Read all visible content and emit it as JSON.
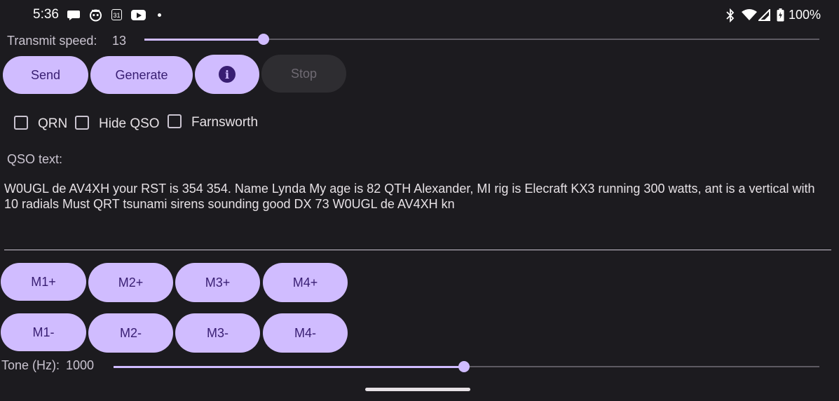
{
  "status_bar": {
    "time": "5:36",
    "calendar_day": "31",
    "battery": "100%",
    "icons": [
      "chat-bubble-icon",
      "robot-icon",
      "calendar-icon",
      "youtube-icon",
      "dot-icon",
      "bluetooth-icon",
      "wifi-icon",
      "signal-icon",
      "battery-icon"
    ]
  },
  "transmit": {
    "label": "Transmit speed:",
    "value": "13",
    "slider_fraction": 0.177
  },
  "buttons": {
    "send": "Send",
    "generate": "Generate",
    "info": "i",
    "stop": "Stop"
  },
  "checkboxes": {
    "qrn": "QRN",
    "hide_qso": "Hide QSO",
    "farnsworth": "Farnsworth"
  },
  "qso": {
    "label": "QSO text:",
    "text": "W0UGL de AV4XH your RST is 354 354. Name Lynda My age is 82 QTH Alexander, MI rig is Elecraft KX3 running 300 watts, ant is a vertical with 10 radials Must QRT tsunami sirens sounding good DX 73  W0UGL de AV4XH kn"
  },
  "memory": {
    "plus": [
      "M1+",
      "M2+",
      "M3+",
      "M4+"
    ],
    "minus": [
      "M1-",
      "M2-",
      "M3-",
      "M4-"
    ]
  },
  "tone": {
    "label": "Tone (Hz):",
    "value": "1000",
    "slider_fraction": 0.497
  },
  "colors": {
    "background": "#1c1b1f",
    "accent": "#d0bcff",
    "on_accent": "#381e72"
  }
}
